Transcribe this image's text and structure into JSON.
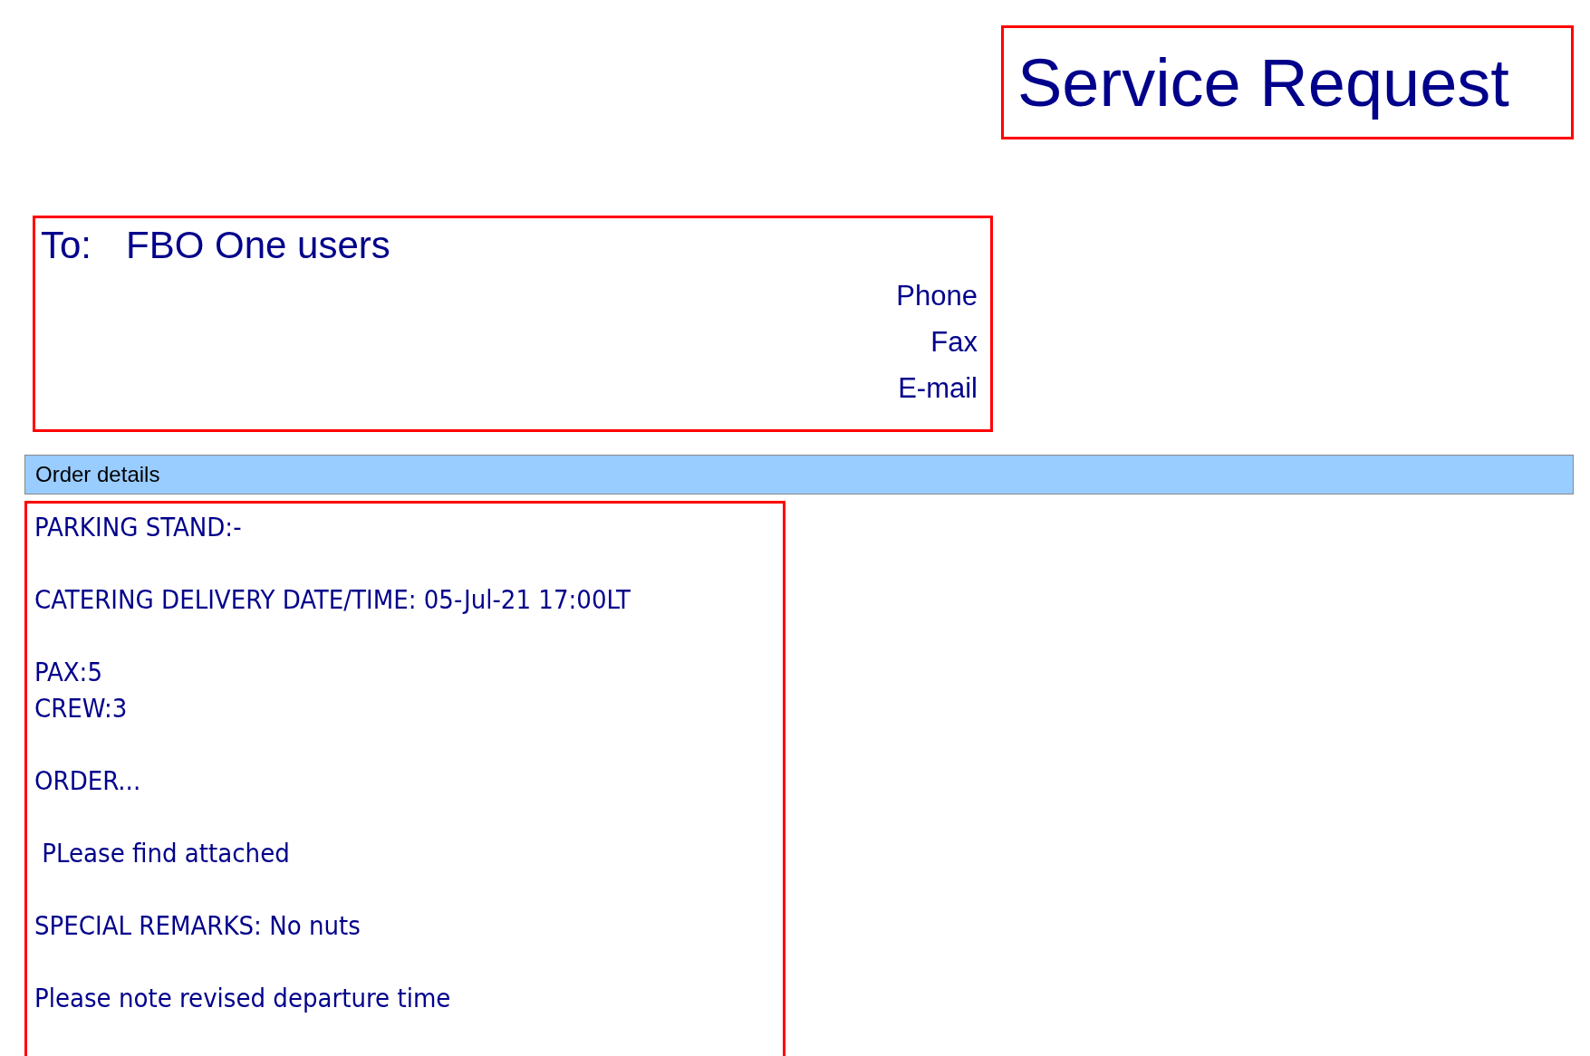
{
  "title": "Service Request",
  "recipient": {
    "label": "To:",
    "name": "FBO One users",
    "contacts": [
      "Phone",
      "Fax",
      "E-mail"
    ]
  },
  "section_header": "Order details",
  "order_paragraphs": [
    {
      "lines": [
        "PARKING STAND:-"
      ]
    },
    {
      "lines": [
        "CATERING DELIVERY DATE/TIME: 05-Jul-21 17:00LT"
      ]
    },
    {
      "lines": [
        "PAX:5",
        "CREW:3"
      ]
    },
    {
      "lines": [
        "ORDER..."
      ]
    },
    {
      "lines": [
        " PLease find attached"
      ]
    },
    {
      "lines": [
        "SPECIAL REMARKS: No nuts"
      ]
    },
    {
      "lines": [
        "Please note revised departure time"
      ]
    }
  ]
}
